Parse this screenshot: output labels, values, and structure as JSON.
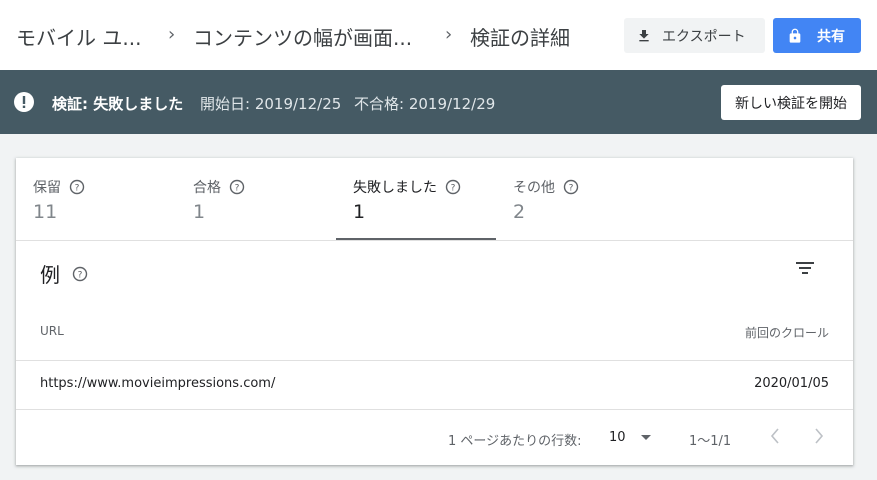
{
  "header": {
    "breadcrumbs": [
      "モバイル ユ...",
      "コンテンツの幅が画面...",
      "検証の詳細"
    ],
    "export_label": "エクスポート",
    "share_label": "共有"
  },
  "status": {
    "title": "検証: 失敗しました",
    "start_date": "開始日: 2019/12/25",
    "fail_date": "不合格: 2019/12/29",
    "new_button": "新しい検証を開始"
  },
  "tabs": [
    {
      "label": "保留",
      "count": "11"
    },
    {
      "label": "合格",
      "count": "1"
    },
    {
      "label": "失敗しました",
      "count": "1"
    },
    {
      "label": "その他",
      "count": "2"
    }
  ],
  "examples": {
    "title": "例",
    "columns": {
      "url": "URL",
      "last_crawl": "前回のクロール"
    },
    "rows": [
      {
        "url": "https://www.movieimpressions.com/",
        "date": "2020/01/05"
      }
    ]
  },
  "pagination": {
    "rows_label": "1 ページあたりの行数:",
    "rows_value": "10",
    "range": "1〜1/1"
  },
  "colors": {
    "status_bg": "#455a64",
    "share_bg": "#4285f4"
  }
}
